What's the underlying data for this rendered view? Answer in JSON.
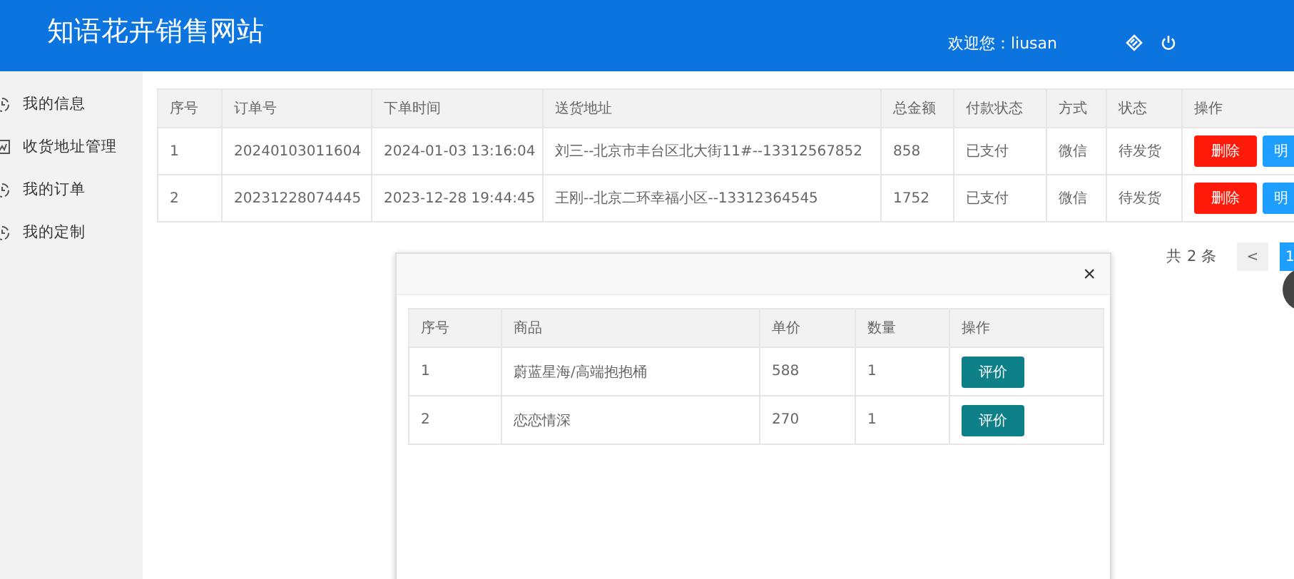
{
  "header": {
    "title": "知语花卉销售网站",
    "welcome": "欢迎您：liusan"
  },
  "sidebar": {
    "items": [
      {
        "label": "我的信息",
        "kind": "clock",
        "selected": false
      },
      {
        "label": "收货地址管理",
        "kind": "box",
        "selected": false
      },
      {
        "label": "我的订单",
        "kind": "clock",
        "selected": false
      },
      {
        "label": "我的定制",
        "kind": "clock",
        "selected": false
      }
    ]
  },
  "orders": {
    "columns": [
      "序号",
      "订单号",
      "下单时间",
      "送货地址",
      "总金额",
      "付款状态",
      "方式",
      "状态",
      "操作"
    ],
    "rows": [
      {
        "cells": [
          "1",
          "20240103011604",
          "2024-01-03 13:16:04",
          "刘三--北京市丰台区北大街11#--13312567852",
          "858",
          "已支付",
          "微信",
          "待发货"
        ],
        "actions": [
          "删除",
          "明"
        ]
      },
      {
        "cells": [
          "2",
          "20231228074445",
          "2023-12-28 19:44:45",
          "王刚--北京二环幸福小区--13312364545",
          "1752",
          "已支付",
          "微信",
          "待发货"
        ],
        "actions": [
          "删除",
          "明"
        ]
      }
    ]
  },
  "pagination": {
    "total": "共 2 条",
    "prev": "<",
    "pages": [
      {
        "label": "1",
        "selected": true
      }
    ]
  },
  "dialog": {
    "close": "×",
    "columns": [
      "序号",
      "商品",
      "单价",
      "数量",
      "操作"
    ],
    "rows": [
      {
        "cells": [
          "1",
          "蔚蓝星海/高端抱抱桶",
          "588",
          "1"
        ],
        "action": "评价"
      },
      {
        "cells": [
          "2",
          "恋恋情深",
          "270",
          "1"
        ],
        "action": "评价"
      }
    ]
  }
}
